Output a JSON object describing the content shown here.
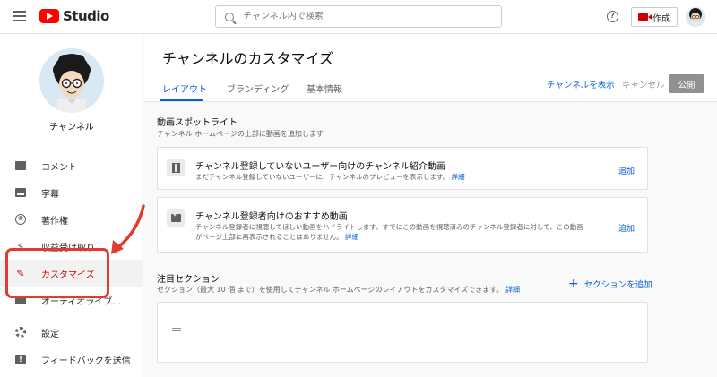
{
  "header": {
    "logo_text": "Studio",
    "search_placeholder": "チャンネル内で検索",
    "help_glyph": "?",
    "create_label": "作成"
  },
  "sidebar": {
    "channel_name": "チャンネル",
    "items": [
      {
        "label": "コメント",
        "icon": "comment-icon"
      },
      {
        "label": "字幕",
        "icon": "subtitles-icon"
      },
      {
        "label": "著作権",
        "icon": "copyright-icon",
        "glyph": "©"
      },
      {
        "label": "収益受け取り",
        "icon": "monetization-icon",
        "glyph": "$"
      },
      {
        "label": "カスタマイズ",
        "icon": "magic-wand-icon",
        "glyph": "✎",
        "active": true
      },
      {
        "label": "オーディオライブ…",
        "icon": "audio-library-icon"
      },
      {
        "label": "設定",
        "icon": "gear-icon"
      },
      {
        "label": "フィードバックを送信",
        "icon": "feedback-icon",
        "glyph": "!"
      }
    ],
    "annotation_color": "#e33b2e"
  },
  "main": {
    "title": "チャンネルのカスタマイズ",
    "tabs": [
      {
        "label": "レイアウト",
        "active": true
      },
      {
        "label": "ブランディング"
      },
      {
        "label": "基本情報"
      }
    ],
    "view_channel": "チャンネルを表示",
    "cancel": "キャンセル",
    "publish": "公開",
    "spotlight": {
      "title": "動画スポットライト",
      "desc": "チャンネル ホームページの上部に動画を追加します",
      "cards": [
        {
          "title": "チャンネル登録していないユーザー向けのチャンネル紹介動画",
          "desc": "まだチャンネル登録していないユーザーに、チャンネルのプレビューを表示します。",
          "link": "詳細",
          "add": "追加"
        },
        {
          "title": "チャンネル登録者向けのおすすめ動画",
          "desc_line1": "チャンネル登録者に視聴してほしい動画をハイライトします。すでにこの動画を視聴済みのチャンネル登録者に対して、この動画",
          "desc_line2": "がページ上部に再表示されることはありません。",
          "link": "詳細",
          "add": "追加"
        }
      ]
    },
    "featured": {
      "title": "注目セクション",
      "desc": "セクション（最大 10 個 まで）を使用してチャンネル ホームページのレイアウトをカスタマイズできます。",
      "link": "詳細",
      "add_section": "セクションを追加",
      "plus": "+"
    }
  },
  "colors": {
    "accent_blue": "#065fd4",
    "brand_red": "#ff0000",
    "annotation_red": "#e33b2e"
  }
}
